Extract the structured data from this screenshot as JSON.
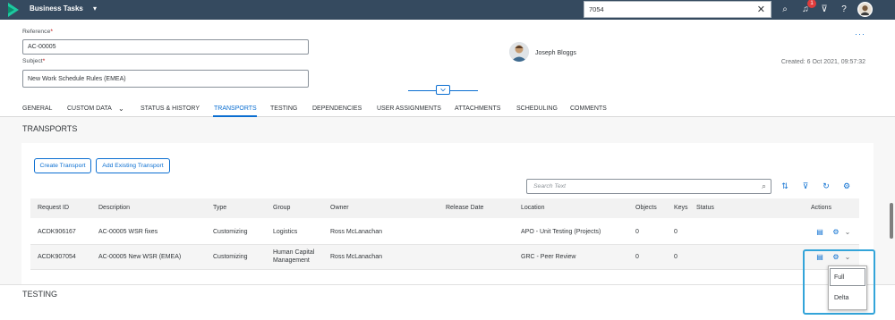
{
  "shell": {
    "title": "Business Tasks",
    "search_value": "7054",
    "notification_count": "1"
  },
  "header": {
    "reference_label": "Reference",
    "reference_value": "AC-00005",
    "subject_label": "Subject",
    "subject_value": "New Work Schedule Rules (EMEA)",
    "required_mark": "*",
    "owner_name": "Joseph Bloggs",
    "created": "Created: 6 Oct 2021, 09:57:32",
    "more": "···"
  },
  "tabs": [
    {
      "label": "GENERAL"
    },
    {
      "label": "CUSTOM DATA"
    },
    {
      "label": "STATUS & HISTORY"
    },
    {
      "label": "TRANSPORTS"
    },
    {
      "label": "TESTING"
    },
    {
      "label": "DEPENDENCIES"
    },
    {
      "label": "USER ASSIGNMENTS"
    },
    {
      "label": "ATTACHMENTS"
    },
    {
      "label": "SCHEDULING"
    },
    {
      "label": "COMMENTS"
    }
  ],
  "transports": {
    "section_title": "TRANSPORTS",
    "create_button": "Create Transport",
    "add_button": "Add Existing Transport",
    "search_placeholder": "Search Text",
    "columns": [
      "Request ID",
      "Description",
      "Type",
      "Group",
      "Owner",
      "Release Date",
      "Location",
      "Objects",
      "Keys",
      "Status",
      "Actions"
    ],
    "rows": [
      {
        "request_id": "ACDK906167",
        "description": "AC-00005 WSR fixes",
        "type": "Customizing",
        "group": "Logistics",
        "group2": "",
        "owner": "Ross McLanachan",
        "release_date": "",
        "location": "APO - Unit Testing (Projects)",
        "objects": "0",
        "keys": "0",
        "status": ""
      },
      {
        "request_id": "ACDK907054",
        "description": "AC-00005 New WSR (EMEA)",
        "type": "Customizing",
        "group": "Human Capital",
        "group2": "Management",
        "owner": "Ross McLanachan",
        "release_date": "",
        "location": "GRC - Peer Review",
        "objects": "0",
        "keys": "0",
        "status": ""
      }
    ]
  },
  "dropdown": {
    "options": [
      "Full",
      "Delta"
    ]
  },
  "testing": {
    "section_title": "TESTING"
  },
  "colors": {
    "shell": "#354a5f",
    "accent": "#0a6ed1",
    "highlight": "#33a4d9"
  }
}
